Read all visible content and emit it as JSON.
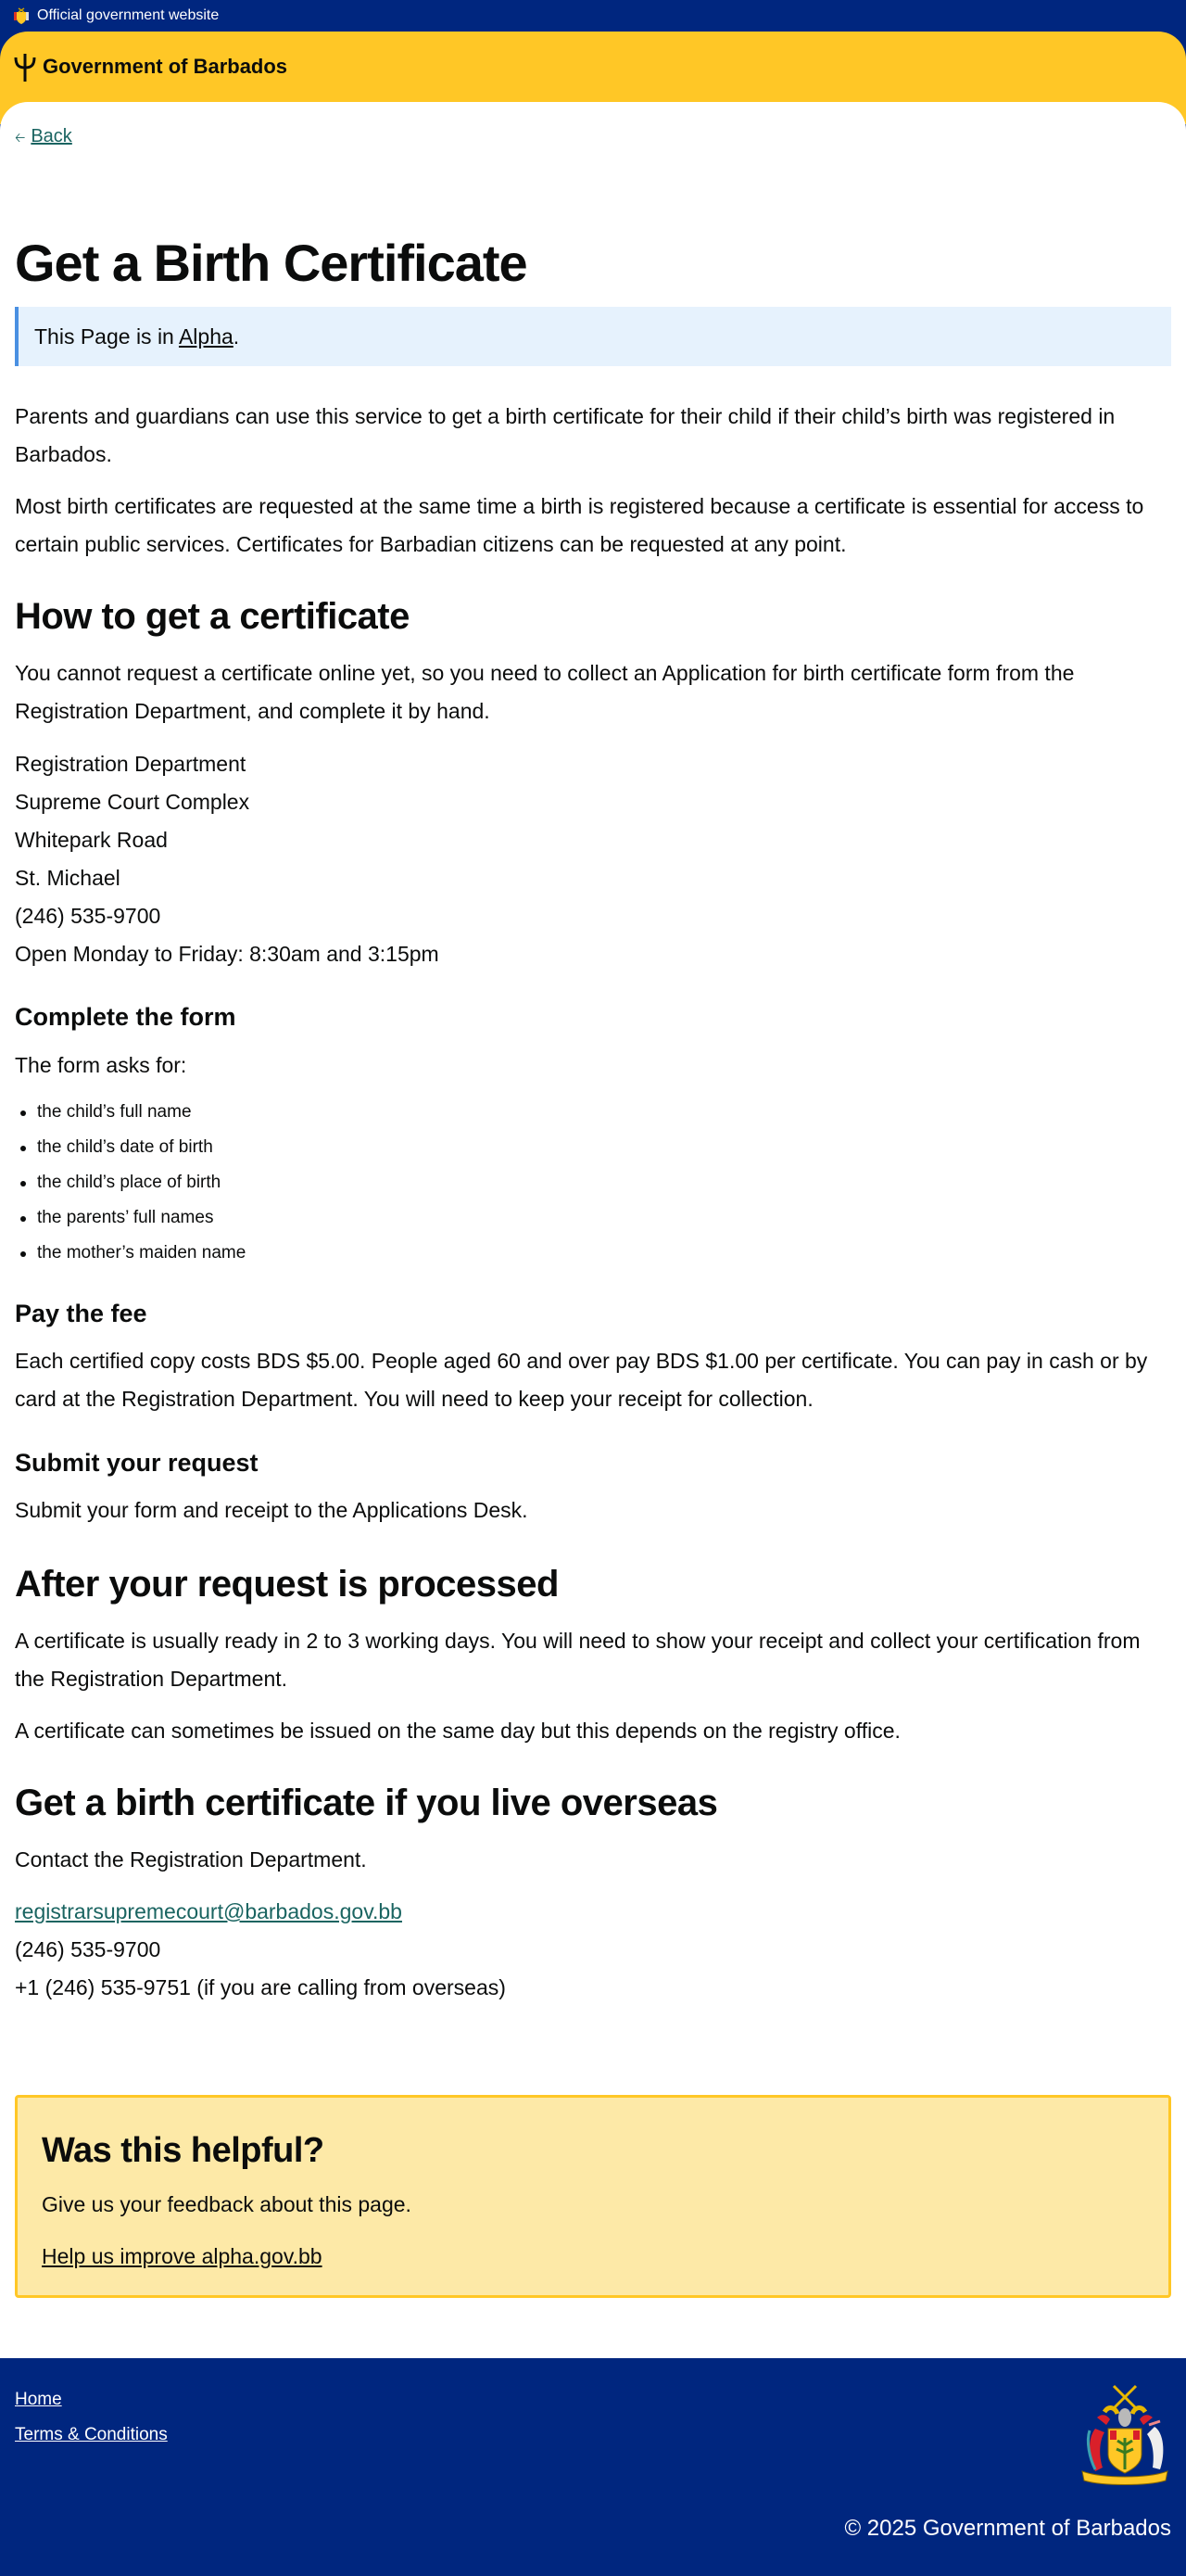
{
  "topbar": {
    "text": "Official government website",
    "crest_icon": "coat-of-arms-icon"
  },
  "header": {
    "title": "Government of Barbados",
    "logo_icon": "trident-icon"
  },
  "back": {
    "label": "Back"
  },
  "page": {
    "title": "Get a Birth Certificate",
    "banner": {
      "prefix": "This Page is in ",
      "link": "Alpha",
      "suffix": "."
    },
    "intro": [
      "Parents and guardians can use this service to get a birth certificate for their child if their child’s birth was registered in Barbados.",
      "Most birth certificates are requested at the same time a birth is registered because a certificate is essential for access to certain public services. Certificates for Barbadian citizens can be requested at any point."
    ],
    "how": {
      "heading": "How to get a certificate",
      "text": "You cannot request a certificate online yet, so you need to collect an Application for birth certificate form from the Registration Department, and complete it by hand.",
      "address": [
        "Registration Department",
        "Supreme Court Complex",
        "Whitepark Road",
        "St. Michael",
        "(246) 535-9700",
        "Open Monday to Friday: 8:30am and 3:15pm"
      ]
    },
    "complete": {
      "heading": "Complete the form",
      "text": "The form asks for:",
      "items": [
        "the child’s full name",
        "the child’s date of birth",
        "the child’s place of birth",
        "the parents’ full names",
        "the mother’s maiden name"
      ]
    },
    "fee": {
      "heading": "Pay the fee",
      "text": "Each certified copy costs BDS $5.00. People aged 60 and over pay BDS $1.00 per certificate. You can pay in cash or by card at the Registration Department. You will need to keep your receipt for collection."
    },
    "submit": {
      "heading": "Submit your request",
      "text": "Submit your form and receipt to the Applications Desk."
    },
    "after": {
      "heading": "After your request is processed",
      "texts": [
        "A certificate is usually ready in 2 to 3 working days. You will need to show your receipt and collect your certification from the Registration Department.",
        "A certificate can sometimes be issued on the same day but this depends on the registry office."
      ]
    },
    "overseas": {
      "heading": "Get a birth certificate if you live overseas",
      "text": "Contact the Registration Department.",
      "email": "registrarsupremecourt@barbados.gov.bb",
      "phone": "(246) 535-9700",
      "phone_overseas": "+1 (246) 535-9751 (if you are calling from overseas)"
    }
  },
  "feedback": {
    "heading": "Was this helpful?",
    "text": "Give us your feedback about this page.",
    "link": "Help us improve alpha.gov.bb"
  },
  "footer": {
    "links": [
      "Home",
      "Terms & Conditions"
    ],
    "copyright": "© 2025 Government of Barbados"
  },
  "colors": {
    "navy": "#00267f",
    "yellow": "#ffc726",
    "link": "#1a6461",
    "banner_bg": "#e6f2fd",
    "banner_border": "#4a90e2",
    "feedback_bg": "#fde9a7"
  }
}
